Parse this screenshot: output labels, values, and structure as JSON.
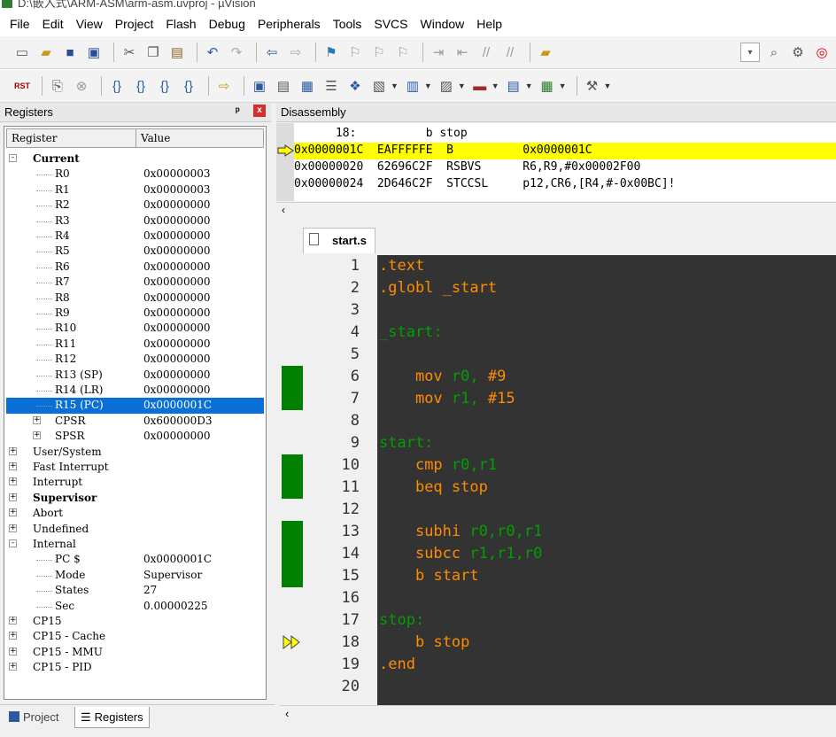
{
  "window": {
    "title": "D:\\嵌入式\\ARM-ASM\\arm-asm.uvproj - µVision"
  },
  "menu": [
    "File",
    "Edit",
    "View",
    "Project",
    "Flash",
    "Debug",
    "Peripherals",
    "Tools",
    "SVCS",
    "Window",
    "Help"
  ],
  "registers_panel": {
    "title": "Registers",
    "pin_icon": "ᵖ",
    "close_icon": "x",
    "col_register": "Register",
    "col_value": "Value",
    "rows": [
      {
        "name": "Current",
        "value": "",
        "bold": true,
        "expander": "-"
      },
      {
        "name": "R0",
        "value": "0x00000003"
      },
      {
        "name": "R1",
        "value": "0x00000003"
      },
      {
        "name": "R2",
        "value": "0x00000000"
      },
      {
        "name": "R3",
        "value": "0x00000000"
      },
      {
        "name": "R4",
        "value": "0x00000000"
      },
      {
        "name": "R5",
        "value": "0x00000000"
      },
      {
        "name": "R6",
        "value": "0x00000000"
      },
      {
        "name": "R7",
        "value": "0x00000000"
      },
      {
        "name": "R8",
        "value": "0x00000000"
      },
      {
        "name": "R9",
        "value": "0x00000000"
      },
      {
        "name": "R10",
        "value": "0x00000000"
      },
      {
        "name": "R11",
        "value": "0x00000000"
      },
      {
        "name": "R12",
        "value": "0x00000000"
      },
      {
        "name": "R13 (SP)",
        "value": "0x00000000"
      },
      {
        "name": "R14 (LR)",
        "value": "0x00000000"
      },
      {
        "name": "R15 (PC)",
        "value": "0x0000001C",
        "selected": true
      },
      {
        "name": "CPSR",
        "value": "0x600000D3",
        "expander": "+"
      },
      {
        "name": "SPSR",
        "value": "0x00000000",
        "expander": "+"
      },
      {
        "name": "User/System",
        "value": "",
        "expander": "+"
      },
      {
        "name": "Fast Interrupt",
        "value": "",
        "expander": "+"
      },
      {
        "name": "Interrupt",
        "value": "",
        "expander": "+"
      },
      {
        "name": "Supervisor",
        "value": "",
        "bold": true,
        "expander": "+"
      },
      {
        "name": "Abort",
        "value": "",
        "expander": "+"
      },
      {
        "name": "Undefined",
        "value": "",
        "expander": "+"
      },
      {
        "name": "Internal",
        "value": "",
        "expander": "-"
      },
      {
        "name": "PC  $",
        "value": "0x0000001C"
      },
      {
        "name": "Mode",
        "value": "Supervisor"
      },
      {
        "name": "States",
        "value": "27"
      },
      {
        "name": "Sec",
        "value": "0.00000225"
      },
      {
        "name": "CP15",
        "value": "",
        "expander": "+"
      },
      {
        "name": "CP15 - Cache",
        "value": "",
        "expander": "+"
      },
      {
        "name": "CP15 - MMU",
        "value": "",
        "expander": "+"
      },
      {
        "name": "CP15 - PID",
        "value": "",
        "expander": "+"
      }
    ]
  },
  "bottom_tabs": {
    "project": "Project",
    "registers": "Registers"
  },
  "disassembly": {
    "title": "Disassembly",
    "lines": [
      {
        "text": "      18:          b stop",
        "highlight": false
      },
      {
        "text": "0x0000001C  EAFFFFFE  B          0x0000001C",
        "highlight": true
      },
      {
        "text": "0x00000020  62696C2F  RSBVS      R6,R9,#0x00002F00",
        "highlight": false
      },
      {
        "text": "0x00000024  2D646C2F  STCCSL     p12,CR6,[R4,#-0x00BC]!",
        "highlight": false
      }
    ]
  },
  "editor": {
    "tab": "start.s",
    "line_numbers": [
      "1",
      "2",
      "3",
      "4",
      "5",
      "6",
      "7",
      "8",
      "9",
      "10",
      "11",
      "12",
      "13",
      "14",
      "15",
      "16",
      "17",
      "18",
      "19",
      "20"
    ],
    "lines": [
      ".text",
      ".globl _start",
      "",
      "_start:",
      "",
      "    mov r0, #9",
      "    mov r1, #15",
      "",
      "start:",
      "    cmp r0,r1",
      "    beq stop",
      "",
      "    subhi r0,r0,r1",
      "    subcc r1,r1,r0",
      "    b start",
      "",
      "stop:",
      "    b stop",
      ".end",
      ""
    ],
    "colors": {
      "keyword": "#ff8c00",
      "label": "#00a000",
      "background": "#333333"
    }
  }
}
